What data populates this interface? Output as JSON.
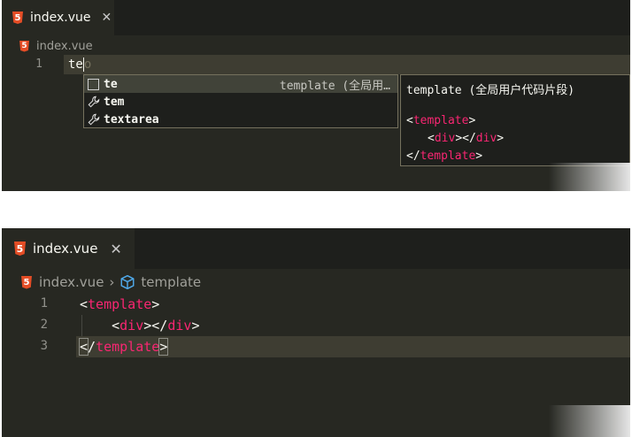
{
  "top": {
    "tab": {
      "icon": "html5-icon",
      "label": "index.vue",
      "close": "✕"
    },
    "breadcrumb": {
      "file": "index.vue"
    },
    "line": {
      "number": "1",
      "typed": "te",
      "ghost": "o"
    },
    "suggest": [
      {
        "icon": "snippet-icon",
        "label": "te",
        "detail": "template (全局用…"
      },
      {
        "icon": "wrench-icon",
        "label": "tem",
        "detail": ""
      },
      {
        "icon": "wrench-icon",
        "label": "textarea",
        "detail": ""
      }
    ],
    "doc": {
      "title": "template (全局用户代码片段)",
      "code_open_lt": "<",
      "code_open_name": "template",
      "code_open_gt": ">",
      "code_div_open": "<",
      "code_div_name": "div",
      "code_div_mid": "></",
      "code_div_name2": "div",
      "code_div_gt": ">",
      "code_close_lt": "</",
      "code_close_name": "template",
      "code_close_gt": ">"
    }
  },
  "bottom": {
    "tab": {
      "icon": "html5-icon",
      "label": "index.vue",
      "close": "✕"
    },
    "breadcrumb": {
      "file": "index.vue",
      "separator": "›",
      "symbol": "template"
    },
    "lines": [
      {
        "number": "1",
        "p1": "<",
        "name": "template",
        "p2": ">"
      },
      {
        "number": "2",
        "indent": "    ",
        "p1": "<",
        "name": "div",
        "mid": "></",
        "name2": "div",
        "p2": ">"
      },
      {
        "number": "3",
        "p0": "<",
        "p1": "/",
        "name": "template",
        "p2": ">"
      }
    ]
  },
  "colors": {
    "bg": "#272822",
    "tab_bar": "#1e1f1c",
    "tag": "#f92672",
    "text": "#f8f8f2",
    "html5": "#e44d26"
  }
}
